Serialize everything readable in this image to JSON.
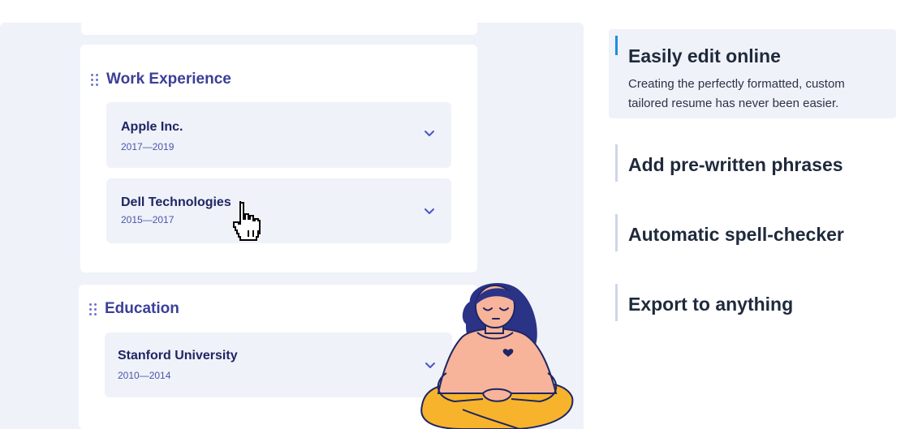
{
  "sections": {
    "work": {
      "title": "Work Experience",
      "entries": [
        {
          "name": "Apple Inc.",
          "dates": "2017—2019"
        },
        {
          "name": "Dell Technologies",
          "dates": "2015—2017"
        }
      ]
    },
    "education": {
      "title": "Education",
      "entries": [
        {
          "name": "Stanford University",
          "dates": "2010—2014"
        }
      ]
    }
  },
  "features": [
    {
      "title": "Easily edit online",
      "description": "Creating the perfectly formatted, custom tailored resume has never been easier."
    },
    {
      "title": "Add pre-written phrases"
    },
    {
      "title": "Automatic spell-checker"
    },
    {
      "title": "Export to anything"
    }
  ],
  "colors": {
    "accent": "#1e8de0",
    "heading": "#3b3f97",
    "panel_bg": "#eff2f9",
    "illustration_skin": "#f7b49a",
    "illustration_hair": "#2b3387",
    "illustration_pants": "#f7b32b"
  },
  "icons": {
    "drag": "drag-handle-icon",
    "chevron": "chevron-down-icon",
    "cursor": "hand-pointer-icon"
  }
}
